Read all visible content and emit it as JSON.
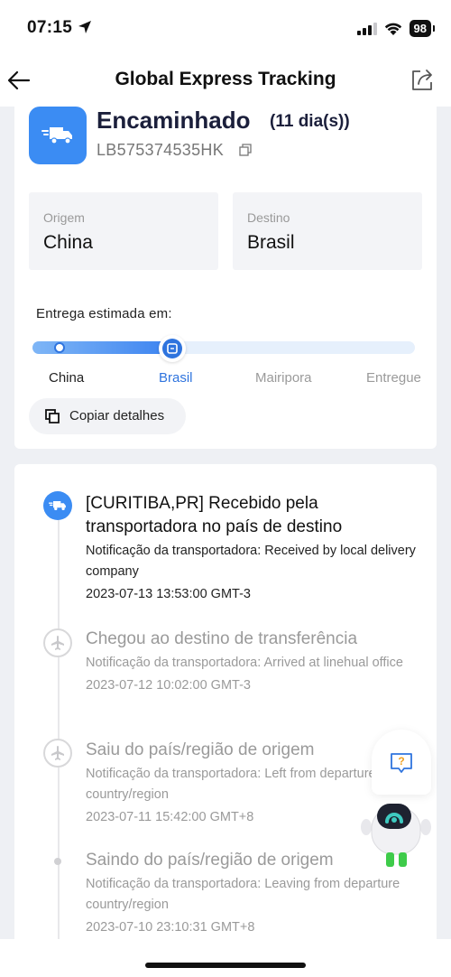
{
  "status_bar": {
    "time": "07:15",
    "battery": "98"
  },
  "header": {
    "title": "Global Express Tracking"
  },
  "shipment": {
    "status": "Encaminhado",
    "days": "(11 dia(s))",
    "tracking_number": "LB575374535HK",
    "origin_label": "Origem",
    "origin_value": "China",
    "destination_label": "Destino",
    "destination_value": "Brasil",
    "eta_label": "Entrega estimada em:",
    "progress": 0.37,
    "steps": [
      "China",
      "Brasil",
      "Mairipora",
      "Entregue"
    ],
    "copy_label": "Copiar detalhes"
  },
  "events": [
    {
      "title": "[CURITIBA,PR] Recebido pela transportadora no país de destino",
      "desc": "Notificação da transportadora: Received by local delivery company",
      "time": "2023-07-13 13:53:00 GMT-3"
    },
    {
      "title": "Chegou ao destino de transferência",
      "desc": "Notificação da transportadora: Arrived at linehual office",
      "time": "2023-07-12 10:02:00 GMT-3"
    },
    {
      "title": "Saiu do país/região de origem",
      "desc": "Notificação da transportadora: Left from departure country/region",
      "time": "2023-07-11 15:42:00 GMT+8"
    },
    {
      "title": "Saindo do país/região de origem",
      "desc": "Notificação da transportadora: Leaving from departure country/region",
      "time": "2023-07-10 23:10:31 GMT+8"
    }
  ],
  "colors": {
    "accent": "#3b8cf3",
    "accent_dark": "#2f74de",
    "muted": "#9a9a9a"
  },
  "icons": [
    "location-arrow-icon",
    "back-arrow-icon",
    "share-icon",
    "truck-icon",
    "copy-icon",
    "airplane-icon",
    "help-icon",
    "robot-assistant-icon"
  ]
}
